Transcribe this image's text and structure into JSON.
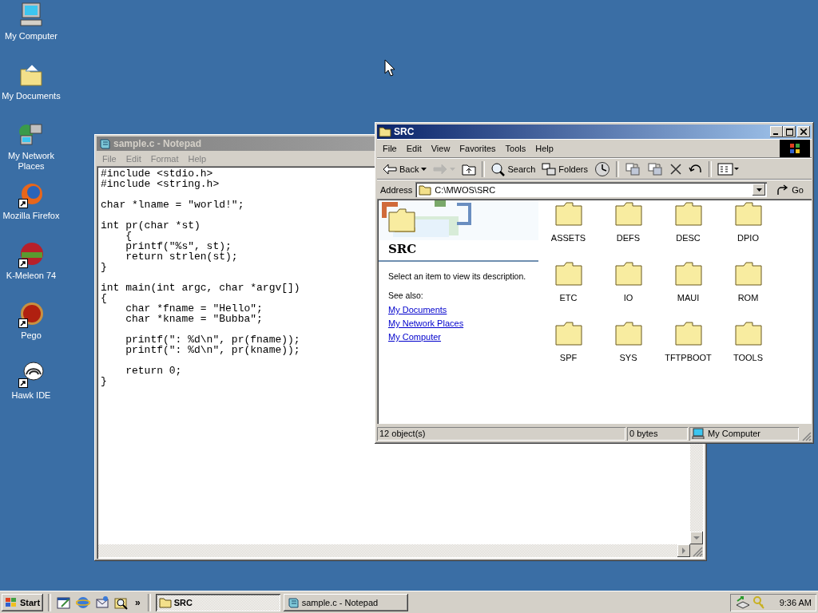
{
  "desktop_icons": [
    {
      "label": "My Computer",
      "kind": "computer",
      "shortcut": false
    },
    {
      "label": "My Documents",
      "kind": "documents",
      "shortcut": false
    },
    {
      "label": "My Network Places",
      "kind": "network",
      "shortcut": false
    },
    {
      "label": "Mozilla Firefox",
      "kind": "firefox",
      "shortcut": true
    },
    {
      "label": "K-Meleon 74",
      "kind": "kmeleon",
      "shortcut": true
    },
    {
      "label": "Pego",
      "kind": "pego",
      "shortcut": true
    },
    {
      "label": "Hawk IDE",
      "kind": "hawk",
      "shortcut": true
    }
  ],
  "notepad": {
    "title": "sample.c - Notepad",
    "active": false,
    "menu": [
      "File",
      "Edit",
      "Format",
      "Help"
    ],
    "text": "#include <stdio.h>\n#include <string.h>\n\nchar *lname = \"world!\";\n\nint pr(char *st)\n    {\n    printf(\"%s\", st);\n    return strlen(st);\n}\n\nint main(int argc, char *argv[])\n{\n    char *fname = \"Hello\";\n    char *kname = \"Bubba\";\n\n    printf(\": %d\\n\", pr(fname));\n    printf(\": %d\\n\", pr(kname));\n\n    return 0;\n}"
  },
  "explorer": {
    "title": "SRC",
    "active": true,
    "menu": [
      "File",
      "Edit",
      "View",
      "Favorites",
      "Tools",
      "Help"
    ],
    "toolbar_groups": [
      [
        {
          "kind": "back",
          "label": "Back",
          "disabled": false
        },
        {
          "kind": "forward",
          "disabled": true
        },
        {
          "kind": "up",
          "disabled": false
        }
      ],
      [
        {
          "kind": "search",
          "label": "Search",
          "disabled": false
        },
        {
          "kind": "folders",
          "label": "Folders",
          "disabled": false
        },
        {
          "kind": "history",
          "disabled": false
        }
      ],
      [
        {
          "kind": "move",
          "disabled": false
        },
        {
          "kind": "copy",
          "disabled": false
        },
        {
          "kind": "delete",
          "disabled": false
        },
        {
          "kind": "undo",
          "disabled": false
        }
      ],
      [
        {
          "kind": "views",
          "disabled": false
        }
      ]
    ],
    "address": {
      "label": "Address",
      "value": "C:\\MWOS\\SRC",
      "go": "Go"
    },
    "panel": {
      "heading": "SRC",
      "description": "Select an item to view its description.",
      "see_also": "See also:",
      "links": [
        "My Documents",
        "My Network Places",
        "My Computer"
      ]
    },
    "folders": [
      "ASSETS",
      "DEFS",
      "DESC",
      "DPIO",
      "ETC",
      "IO",
      "MAUI",
      "ROM",
      "SPF",
      "SYS",
      "TFTPBOOT",
      "TOOLS"
    ],
    "status": {
      "objects": "12 object(s)",
      "size": "0 bytes",
      "zone": "My Computer"
    }
  },
  "taskbar": {
    "start": "Start",
    "more": "»",
    "tasks": [
      {
        "label": "SRC",
        "kind": "folder",
        "selected": true
      },
      {
        "label": "sample.c - Notepad",
        "kind": "notepad",
        "selected": false
      }
    ],
    "clock": "9:36 AM"
  }
}
